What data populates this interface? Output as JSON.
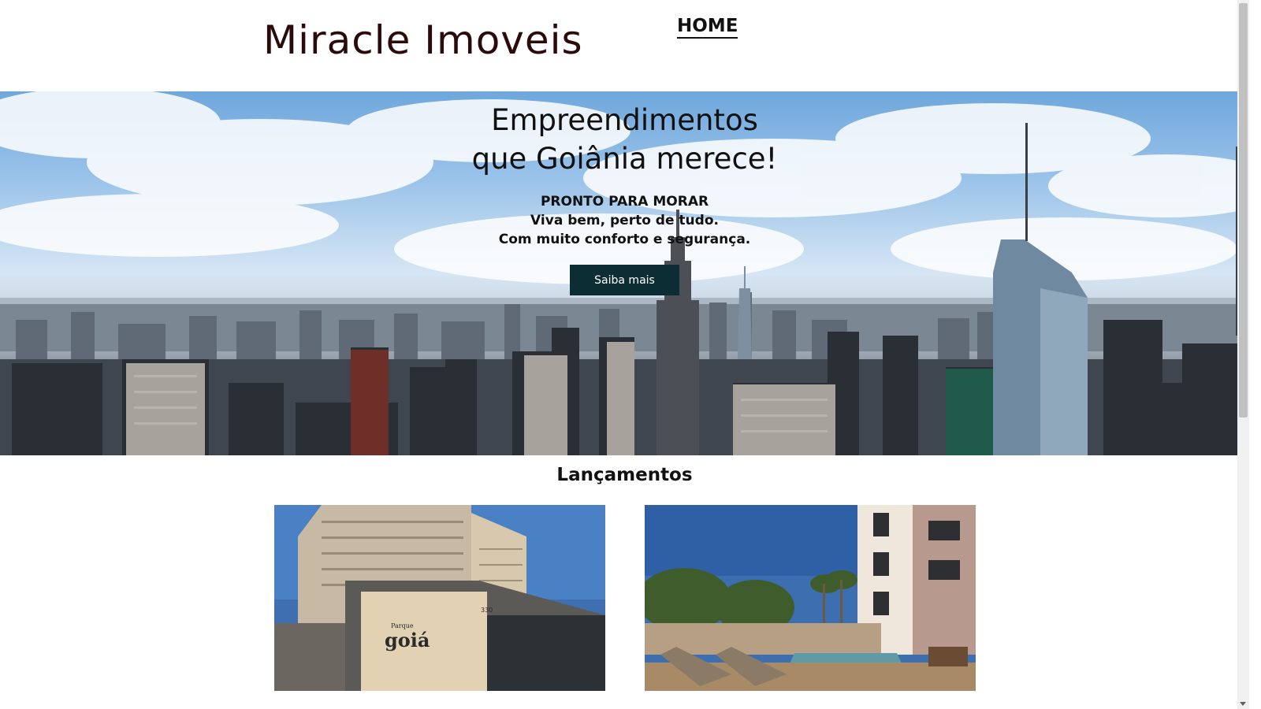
{
  "header": {
    "brand": "Miracle Imoveis",
    "nav": {
      "home_label": "HOME"
    }
  },
  "hero": {
    "title_line1": "Empreendimentos",
    "title_line2": "que Goiânia merece!",
    "sub_line1": "PRONTO PARA MORAR",
    "sub_line2": "Viva bem, perto de tudo.",
    "sub_line3": "Com muito conforto e segurança.",
    "cta_label": "Saiba mais"
  },
  "launches": {
    "title": "Lançamentos",
    "cards": [
      {
        "sign_small": "Parque",
        "sign_big": "goiá",
        "sign_number": "330"
      },
      {}
    ]
  },
  "colors": {
    "cta_background": "#0d2d35",
    "brand_text": "#2a0a0a"
  }
}
